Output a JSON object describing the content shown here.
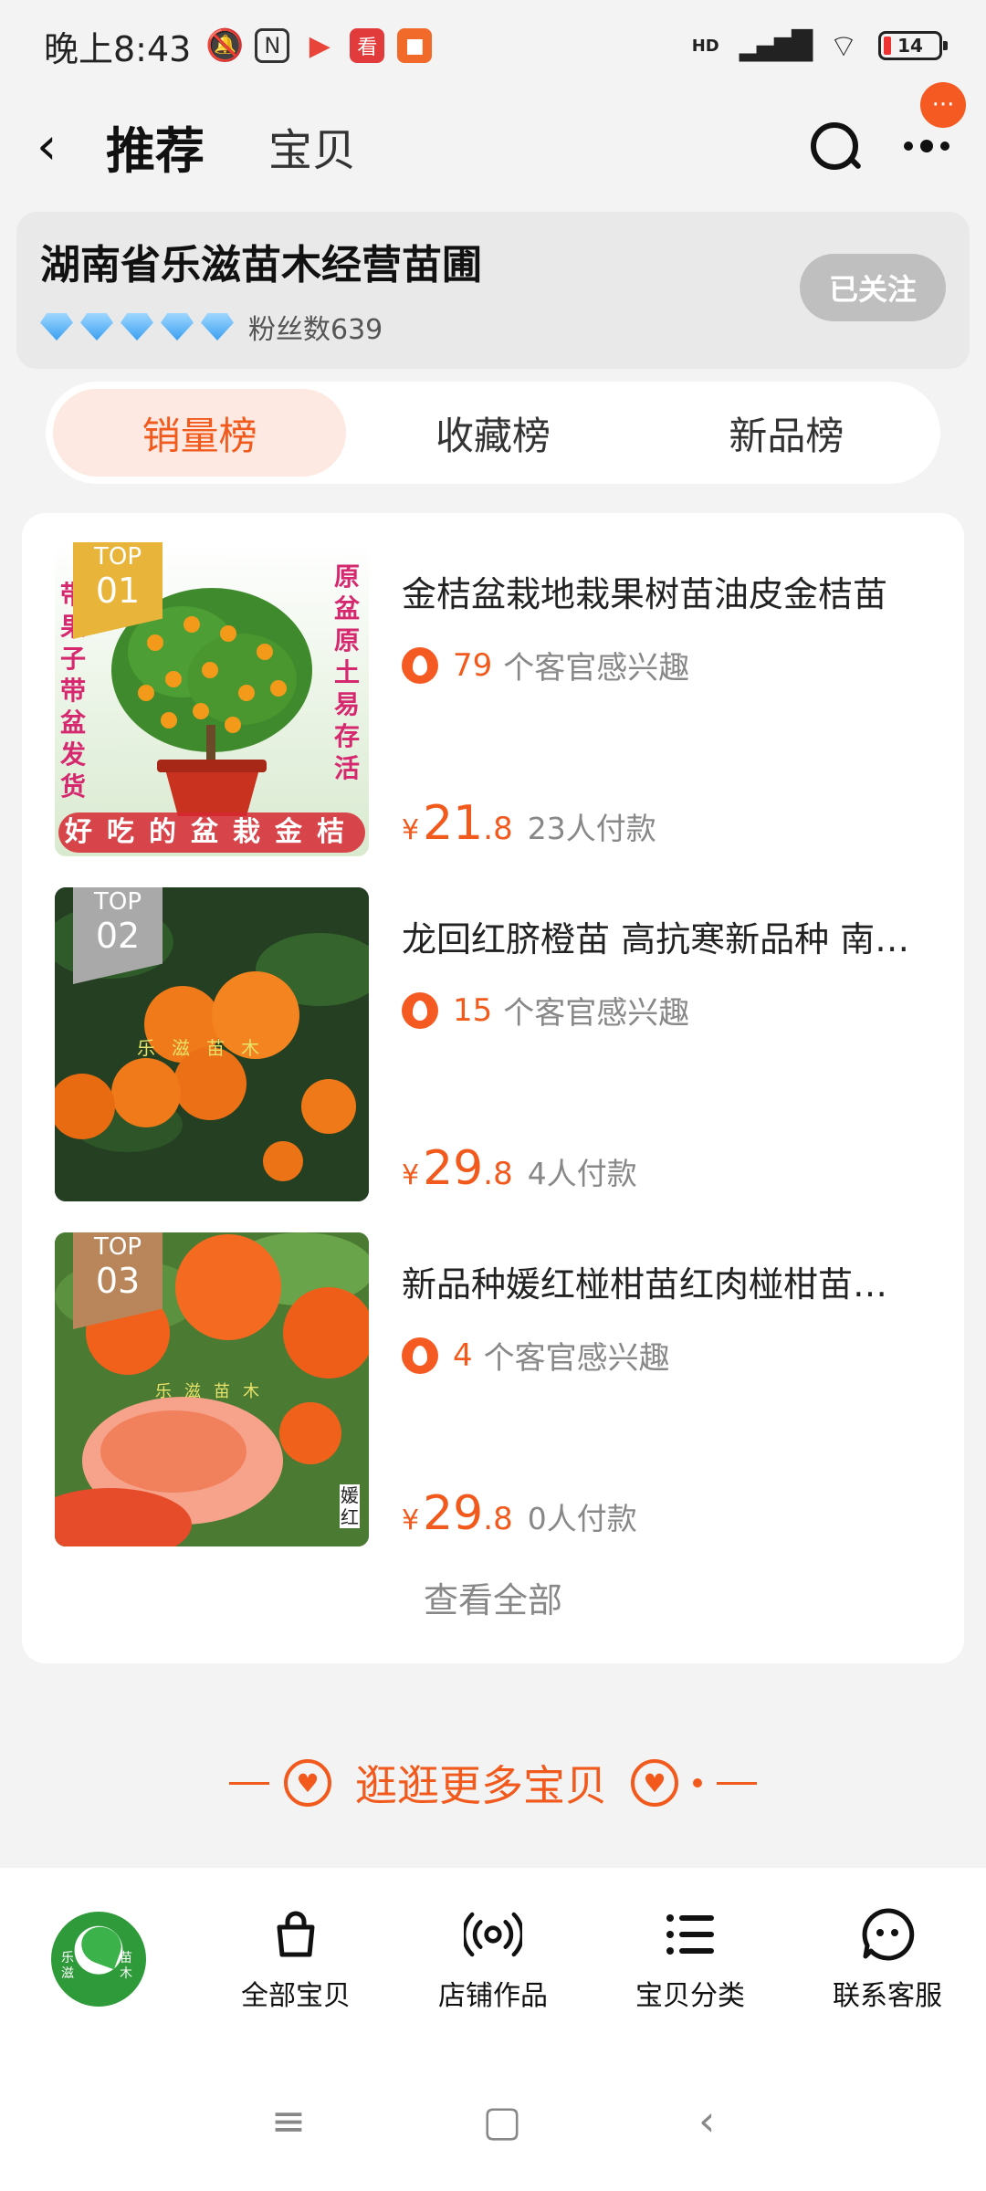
{
  "status": {
    "time": "晚上8:43",
    "network": "HD",
    "battery": "14",
    "app_icons": [
      "mute-icon",
      "nfc-icon",
      "play-icon",
      "news-icon",
      "app-icon"
    ]
  },
  "nav": {
    "active_tab": "推荐",
    "other_tab": "宝贝",
    "badge": "···"
  },
  "shop": {
    "name": "湖南省乐滋苗木经营苗圃",
    "fans": "粉丝数639",
    "follow_label": "已关注",
    "diamonds": 5
  },
  "rank_tabs": [
    {
      "label": "销量榜",
      "active": true
    },
    {
      "label": "收藏榜",
      "active": false
    },
    {
      "label": "新品榜",
      "active": false
    }
  ],
  "items": [
    {
      "rank_top": "TOP",
      "rank_num": "01",
      "tag_color": "#e8b43a",
      "title": "金桔盆栽地栽果树苗油皮金桔苗",
      "interest_count": "79",
      "interest_text": "个客官感兴趣",
      "price_yen": "¥",
      "price_int": "21",
      "price_dec": ".8",
      "paid": "23人付款",
      "image_text_left": "带果子带盆发货",
      "image_text_right": "原盆原土易存活",
      "image_banner": "好吃的盆栽金桔"
    },
    {
      "rank_top": "TOP",
      "rank_num": "02",
      "tag_color": "#a9a9a9",
      "title": "龙回红脐橙苗 高抗寒新品种 南北方种植",
      "interest_count": "15",
      "interest_text": "个客官感兴趣",
      "price_yen": "¥",
      "price_int": "29",
      "price_dec": ".8",
      "paid": "4人付款",
      "image_watermark": "乐滋苗木"
    },
    {
      "rank_top": "TOP",
      "rank_num": "03",
      "tag_color": "#b8865a",
      "title": "新品种媛红椪柑苗红肉椪柑苗嫁接苗",
      "interest_count": "4",
      "interest_text": "个客官感兴趣",
      "price_yen": "¥",
      "price_int": "29",
      "price_dec": ".8",
      "paid": "0人付款",
      "image_watermark": "乐滋苗木",
      "image_side": "媛红"
    }
  ],
  "view_all": "查看全部",
  "more_heading": "逛逛更多宝贝",
  "bottom_nav": [
    {
      "label": "全部宝贝",
      "icon": "shopping-bag-icon"
    },
    {
      "label": "店铺作品",
      "icon": "broadcast-icon"
    },
    {
      "label": "宝贝分类",
      "icon": "list-icon"
    },
    {
      "label": "联系客服",
      "icon": "chat-face-icon"
    }
  ],
  "logo": {
    "text_left": "乐滋",
    "text_right": "苗木"
  },
  "sys_nav": [
    "≡",
    "▢",
    "‹"
  ]
}
